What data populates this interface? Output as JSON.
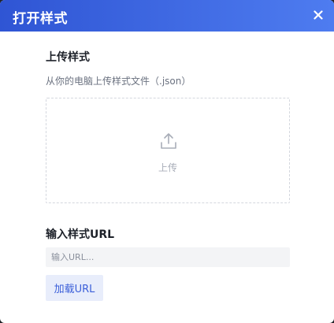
{
  "dialog": {
    "title": "打开样式",
    "close_icon": "close-icon"
  },
  "upload_section": {
    "title": "上传样式",
    "description": "从你的电脑上传样式文件（.json）",
    "upload_label": "上传",
    "upload_icon": "upload-icon"
  },
  "url_section": {
    "title": "输入样式URL",
    "input_placeholder": "输入URL...",
    "input_value": "",
    "load_button_label": "加载URL"
  },
  "colors": {
    "header_gradient_start": "#2f55d4",
    "header_gradient_end": "#4e7cf0",
    "accent": "#3b5fd9",
    "button_bg": "#e8edfb"
  }
}
